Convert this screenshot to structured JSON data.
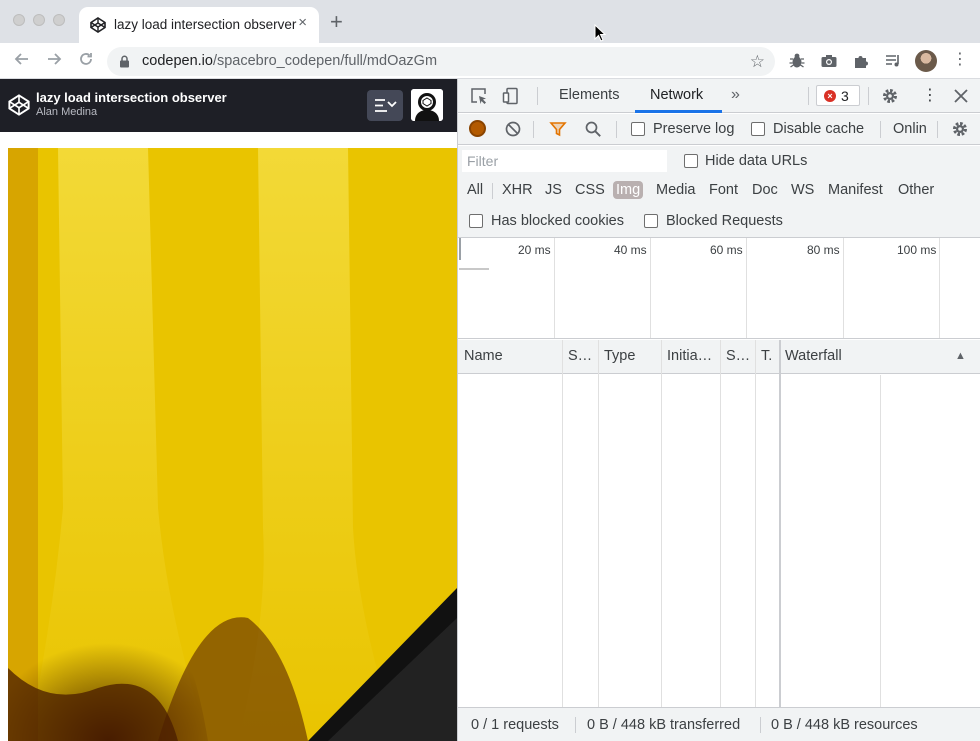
{
  "browser": {
    "tab_title": "lazy load intersection observer",
    "tab_close": "×",
    "new_tab": "+",
    "url_host": "codepen.io",
    "url_path": "/spacebro_codepen/full/mdOazGm"
  },
  "codepen": {
    "title": "lazy load intersection observer",
    "author": "Alan Medina"
  },
  "devtools": {
    "tabs": [
      {
        "label": "Elements",
        "active": false
      },
      {
        "label": "Network",
        "active": true
      }
    ],
    "more_tabs": "»",
    "error_count": "3",
    "toolbar": {
      "preserve_log": "Preserve log",
      "disable_cache": "Disable cache",
      "throttling": "Onlin"
    },
    "filter": {
      "placeholder": "Filter",
      "hide_data_urls": "Hide data URLs"
    },
    "types": [
      "All",
      "XHR",
      "JS",
      "CSS",
      "Img",
      "Media",
      "Font",
      "Doc",
      "WS",
      "Manifest",
      "Other"
    ],
    "active_type": "Img",
    "blocked": {
      "has_blocked_cookies": "Has blocked cookies",
      "blocked_requests": "Blocked Requests"
    },
    "overview_ticks": [
      "20 ms",
      "40 ms",
      "60 ms",
      "80 ms",
      "100 ms"
    ],
    "columns": [
      "Name",
      "S…",
      "Type",
      "Initia…",
      "S…",
      "T.",
      "Waterfall"
    ],
    "sort_indicator": "▲",
    "status": {
      "requests": "0 / 1 requests",
      "transferred": "0 B / 448 kB transferred",
      "resources": "0 B / 448 kB resources"
    }
  }
}
